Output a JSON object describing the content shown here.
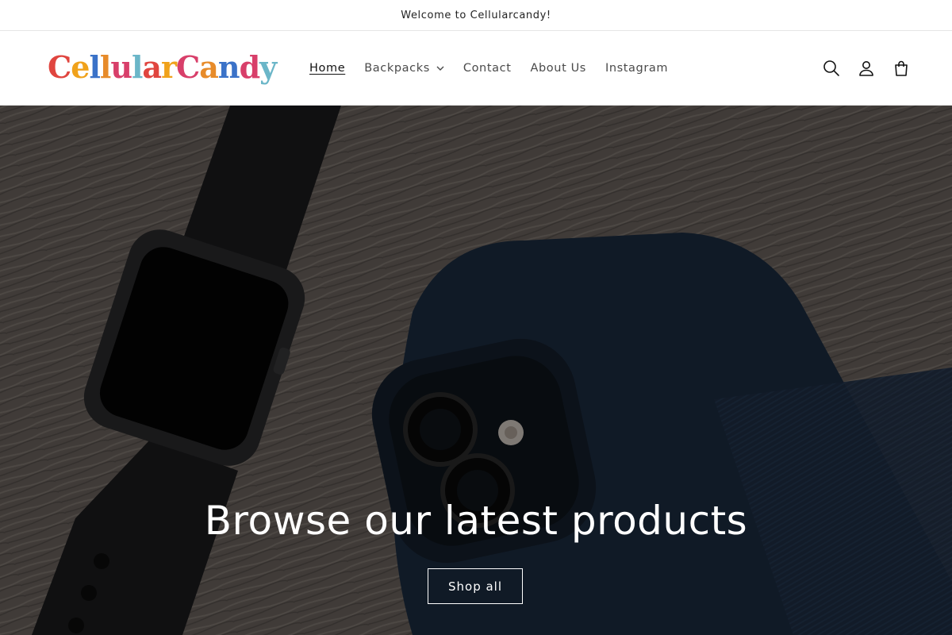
{
  "announcement": {
    "text": "Welcome to Cellularcandy!"
  },
  "header": {
    "logo_alt": "CellularCandy",
    "logo_letters": [
      "C",
      "e",
      "l",
      "l",
      "u",
      "l",
      "a",
      "r",
      "C",
      "a",
      "n",
      "d",
      "y"
    ],
    "nav": [
      {
        "label": "Home",
        "active": true
      },
      {
        "label": "Backpacks",
        "has_dropdown": true
      },
      {
        "label": "Contact"
      },
      {
        "label": "About Us"
      },
      {
        "label": "Instagram"
      }
    ],
    "icons": [
      "search-icon",
      "account-icon",
      "cart-icon"
    ]
  },
  "hero": {
    "title": "Browse our latest products",
    "button_label": "Shop all"
  },
  "colors": {
    "text": "#121212",
    "muted": "#4a4a4a",
    "border": "#e6e6e6",
    "hero_overlay": "#000000"
  }
}
